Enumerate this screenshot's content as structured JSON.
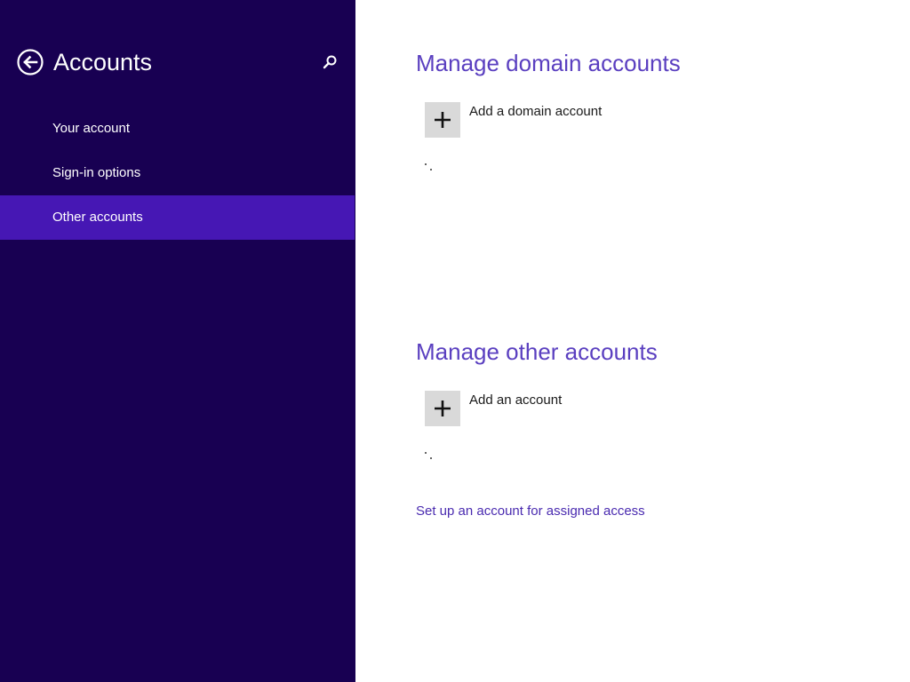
{
  "sidebar": {
    "title": "Accounts",
    "back_icon": "back-arrow-circle-icon",
    "search_icon": "search-icon",
    "items": [
      {
        "label": "Your account",
        "selected": false
      },
      {
        "label": "Sign-in options",
        "selected": false
      },
      {
        "label": "Other accounts",
        "selected": true
      }
    ]
  },
  "main": {
    "domain_section": {
      "heading": "Manage domain accounts",
      "add_label": "Add a domain account",
      "add_icon": "plus-icon"
    },
    "other_section": {
      "heading": "Manage other accounts",
      "add_label": "Add an account",
      "add_icon": "plus-icon"
    },
    "assigned_access_link": "Set up an account for assigned access"
  },
  "colors": {
    "sidebar_bg": "#180052",
    "selected_bg": "#4617b4",
    "heading_text": "#5a3fc0",
    "link_text": "#4a2bb0",
    "tile_bg": "#d9d9d9"
  }
}
